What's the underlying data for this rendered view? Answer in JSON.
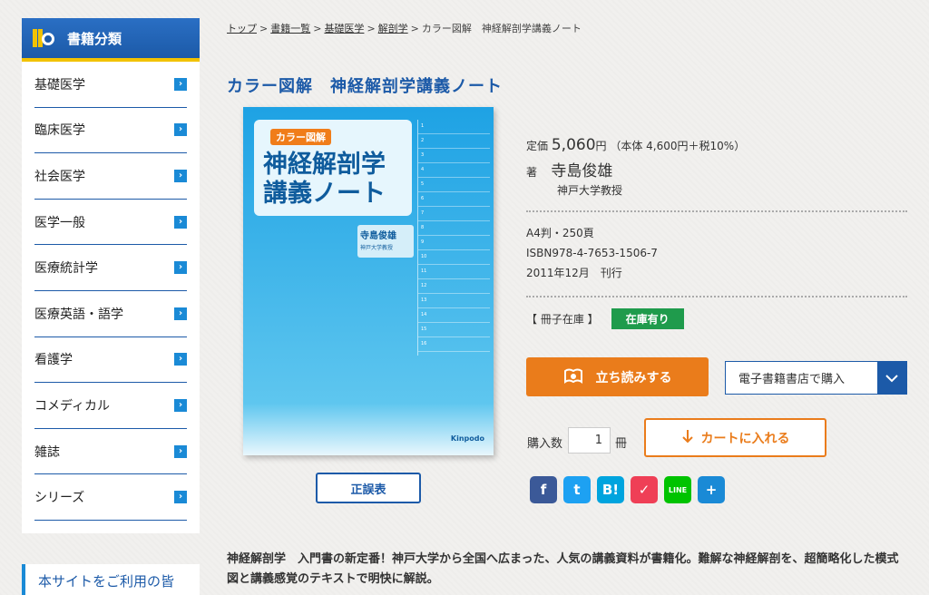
{
  "sidebar": {
    "title": "書籍分類",
    "items": [
      {
        "label": "基礎医学"
      },
      {
        "label": "臨床医学"
      },
      {
        "label": "社会医学"
      },
      {
        "label": "医学一般"
      },
      {
        "label": "医療統計学"
      },
      {
        "label": "医療英語・語学"
      },
      {
        "label": "看護学"
      },
      {
        "label": "コメディカル"
      },
      {
        "label": "雑誌"
      },
      {
        "label": "シリーズ"
      }
    ],
    "arrow": "›",
    "notice": "本サイトをご利用の皆"
  },
  "breadcrumb": {
    "items": [
      "トップ",
      "書籍一覧",
      "基礎医学",
      "解剖学"
    ],
    "current": "カラー図解　神経解剖学講義ノート",
    "separator": ">"
  },
  "book": {
    "title": "カラー図解　神経解剖学講義ノート",
    "cover": {
      "tag": "カラー図解",
      "line1": "神経解剖学",
      "line2": "講義ノート",
      "author": "寺島俊雄",
      "author_sub": "神戸大学教授",
      "publisher": "Kinpodo",
      "toc": [
        "1",
        "2",
        "3",
        "4",
        "5",
        "6",
        "7",
        "8",
        "9",
        "10",
        "11",
        "12",
        "13",
        "14",
        "15",
        "16"
      ]
    },
    "errata_label": "正誤表",
    "price_label": "定価",
    "price": "5,060",
    "price_unit": "円",
    "price_detail": "（本体 4,600円＋税10%）",
    "author_prefix": "著",
    "author": "寺島俊雄",
    "affiliation": "神戸大学教授",
    "format": "A4判・250頁",
    "isbn": "ISBN978-4-7653-1506-7",
    "published": "2011年12月　刊行",
    "stock_label": "【 冊子在庫 】",
    "stock_status": "在庫有り"
  },
  "actions": {
    "preview_label": "立ち読みする",
    "ebook_select": "電子書籍書店で購入",
    "qty_label": "購入数",
    "qty_value": "1",
    "qty_unit": "冊",
    "cart_label": "カートに入れる"
  },
  "share": [
    {
      "name": "facebook",
      "glyph": "f",
      "color": "#3b5998"
    },
    {
      "name": "twitter",
      "glyph": "t",
      "color": "#1da1f2"
    },
    {
      "name": "hatena",
      "glyph": "B!",
      "color": "#00a4de"
    },
    {
      "name": "pocket",
      "glyph": "✓",
      "color": "#ef3f56"
    },
    {
      "name": "line",
      "glyph": "LINE",
      "color": "#00c300"
    },
    {
      "name": "share",
      "glyph": "+",
      "color": "#1a8ad6"
    }
  ],
  "description": "神経解剖学　入門書の新定番！神戸大学から全国へ広まった、人気の講義資料が書籍化。難解な神経解剖を、超簡略化した模式図と講義感覚のテキストで明快に解説。"
}
